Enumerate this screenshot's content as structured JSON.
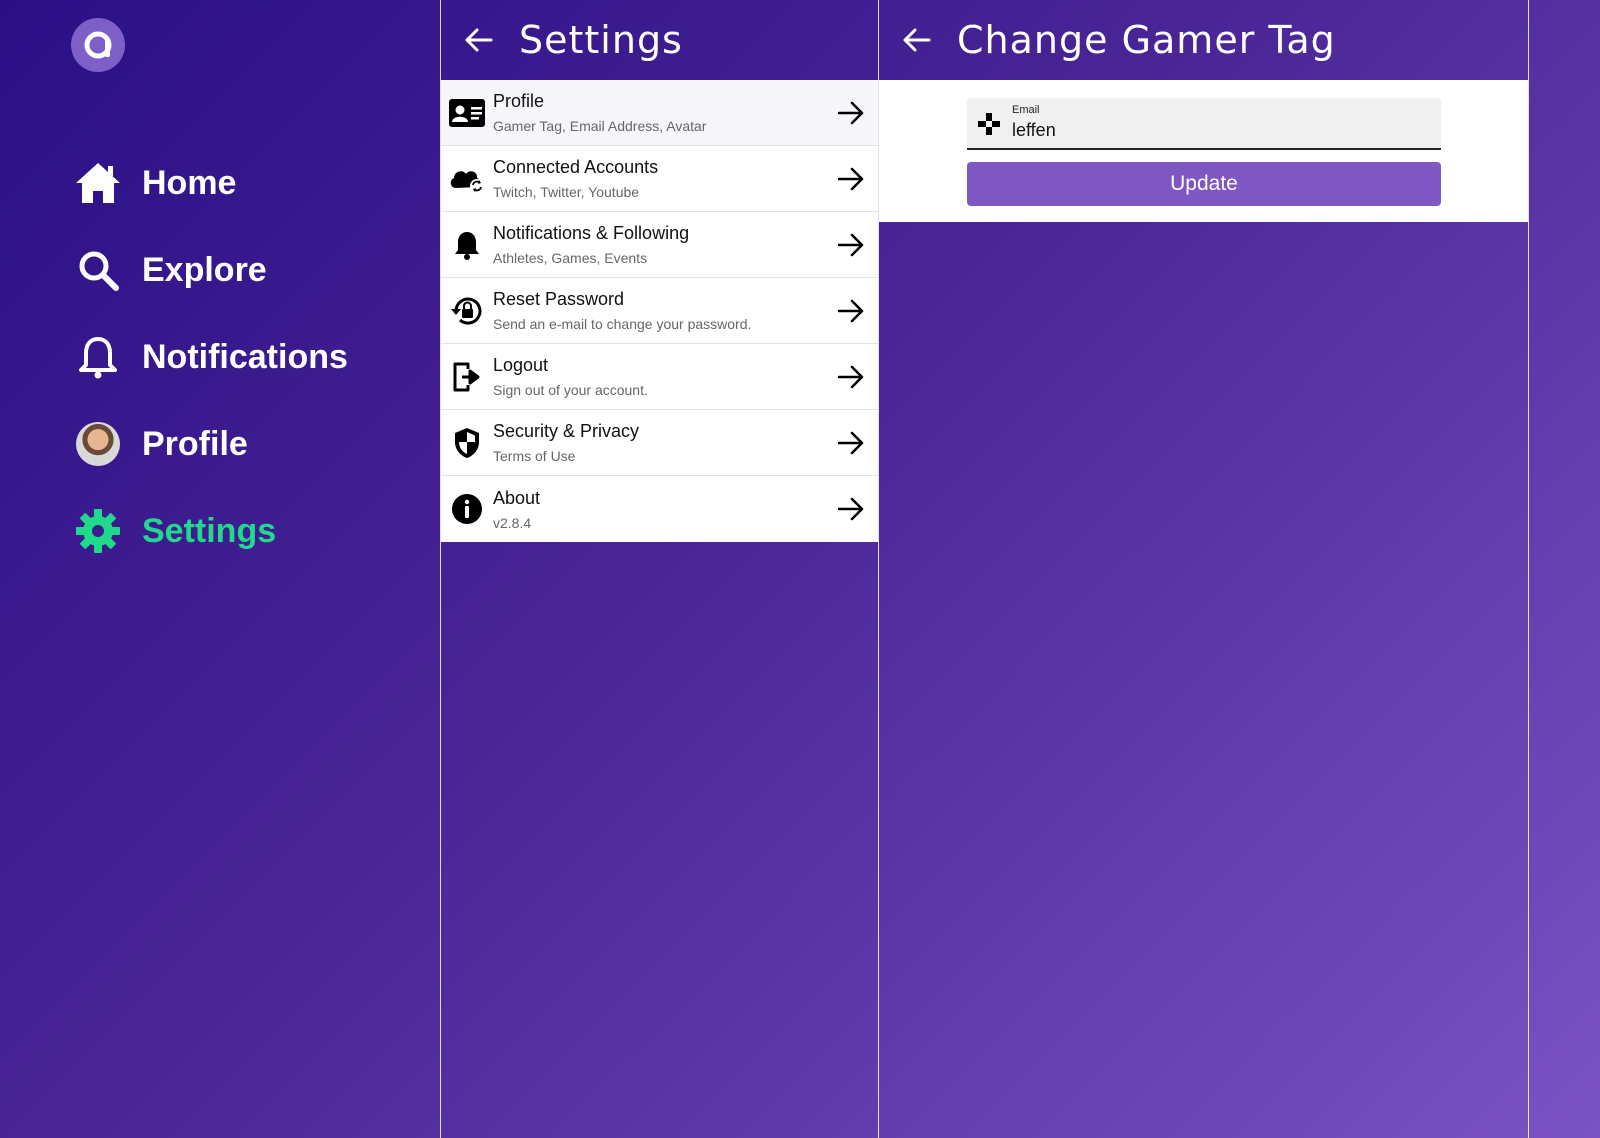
{
  "nav": {
    "logo_letter": "a",
    "items": [
      {
        "label": "Home",
        "icon": "home-icon"
      },
      {
        "label": "Explore",
        "icon": "search-icon"
      },
      {
        "label": "Notifications",
        "icon": "bell-icon"
      },
      {
        "label": "Profile",
        "icon": "avatar"
      },
      {
        "label": "Settings",
        "icon": "gear-icon",
        "active": true
      }
    ],
    "active_color": "#20d98a"
  },
  "settings": {
    "title": "Settings",
    "items": [
      {
        "title": "Profile",
        "subtitle": "Gamer Tag, Email Address, Avatar",
        "icon": "id-card-icon"
      },
      {
        "title": "Connected Accounts",
        "subtitle": "Twitch, Twitter, Youtube",
        "icon": "cloud-sync-icon"
      },
      {
        "title": "Notifications & Following",
        "subtitle": "Athletes, Games, Events",
        "icon": "bell-icon"
      },
      {
        "title": "Reset Password",
        "subtitle": "Send an e-mail to change your password.",
        "icon": "lock-reset-icon"
      },
      {
        "title": "Logout",
        "subtitle": "Sign out of your account.",
        "icon": "logout-icon"
      },
      {
        "title": "Security & Privacy",
        "subtitle": "Terms of Use",
        "icon": "shield-icon"
      },
      {
        "title": "About",
        "subtitle": "v2.8.4",
        "icon": "info-icon"
      }
    ]
  },
  "gamer_tag": {
    "title": "Change Gamer Tag",
    "field_label": "Email",
    "field_value": "leffen",
    "field_icon": "gamepad-icon",
    "button_label": "Update",
    "button_color": "#7f57c3"
  }
}
